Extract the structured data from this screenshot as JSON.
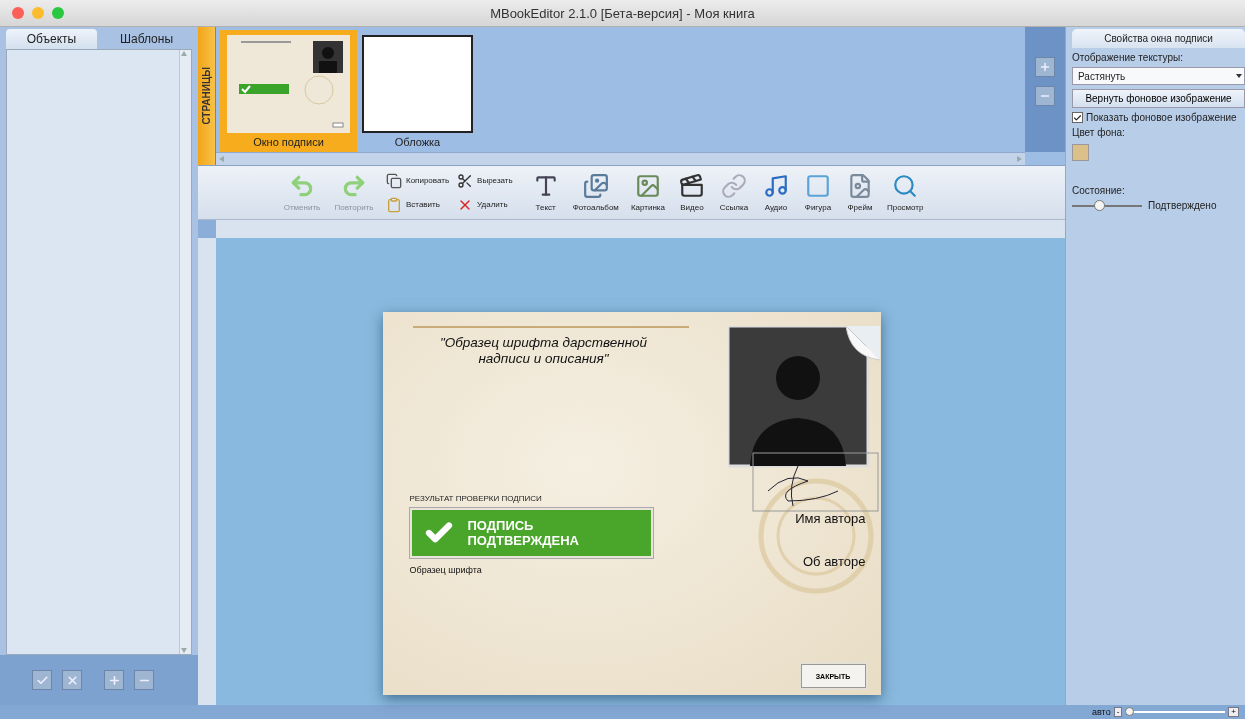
{
  "window": {
    "title": "MBookEditor 2.1.0 [Бета-версия] - Моя книга"
  },
  "left_panel": {
    "tabs": [
      {
        "label": "Объекты",
        "selected": true
      },
      {
        "label": "Шаблоны",
        "selected": false
      }
    ],
    "buttons": [
      {
        "kind": "check"
      },
      {
        "kind": "cross"
      },
      {
        "kind": "plus"
      },
      {
        "kind": "minus"
      }
    ]
  },
  "pages": {
    "label": "СТРАНИЦЫ",
    "thumbnails": [
      {
        "label": "Окно подписи",
        "selected": true,
        "kind": "signature"
      },
      {
        "label": "Обложка",
        "selected": false,
        "kind": "blank"
      }
    ]
  },
  "toolbar": {
    "history": [
      {
        "label": "Отменить",
        "kind": "undo",
        "disabled": true
      },
      {
        "label": "Повторить",
        "kind": "redo",
        "disabled": true
      }
    ],
    "clipboard": [
      {
        "label": "Копировать",
        "kind": "copy"
      },
      {
        "label": "Вырезать",
        "kind": "cut"
      },
      {
        "label": "Вставить",
        "kind": "paste"
      },
      {
        "label": "Удалить",
        "kind": "delete"
      }
    ],
    "tools": [
      {
        "label": "Текст",
        "kind": "text"
      },
      {
        "label": "Фотоальбом",
        "kind": "album"
      },
      {
        "label": "Картинка",
        "kind": "picture"
      },
      {
        "label": "Видео",
        "kind": "video"
      },
      {
        "label": "Ссылка",
        "kind": "link"
      },
      {
        "label": "Аудио",
        "kind": "audio"
      },
      {
        "label": "Фигура",
        "kind": "shape"
      },
      {
        "label": "Фрейм",
        "kind": "frame"
      },
      {
        "label": "Просмотр",
        "kind": "preview"
      }
    ]
  },
  "document": {
    "title": "\"Образец шрифта дарственной надписи и описания\"",
    "result_label": "РЕЗУЛЬТАТ ПРОВЕРКИ ПОДПИСИ",
    "verified": true,
    "status_text": "ПОДПИСЬ ПОДТВЕРЖДЕНА",
    "font_sample": "Образец шрифта",
    "author_name": "Имя автора",
    "about_author": "Об авторе",
    "close_button": "ЗАКРЫТЬ"
  },
  "properties": {
    "tab": "Свойства окна подписи",
    "texture_label": "Отображение текстуры:",
    "texture_value": "Растянуть",
    "reset_button": "Вернуть фоновое изображение",
    "show_background": {
      "label": "Показать фоновое изображение",
      "checked": true
    },
    "bg_color_label": "Цвет фона:",
    "state_label": "Состояние:",
    "state": {
      "level": 0.38,
      "reading": "Подтверждено"
    }
  },
  "status_bar": {
    "zoom_label": "авто",
    "zoom_out": "-",
    "zoom": {
      "level": 0.05
    },
    "zoom_in": "+"
  }
}
